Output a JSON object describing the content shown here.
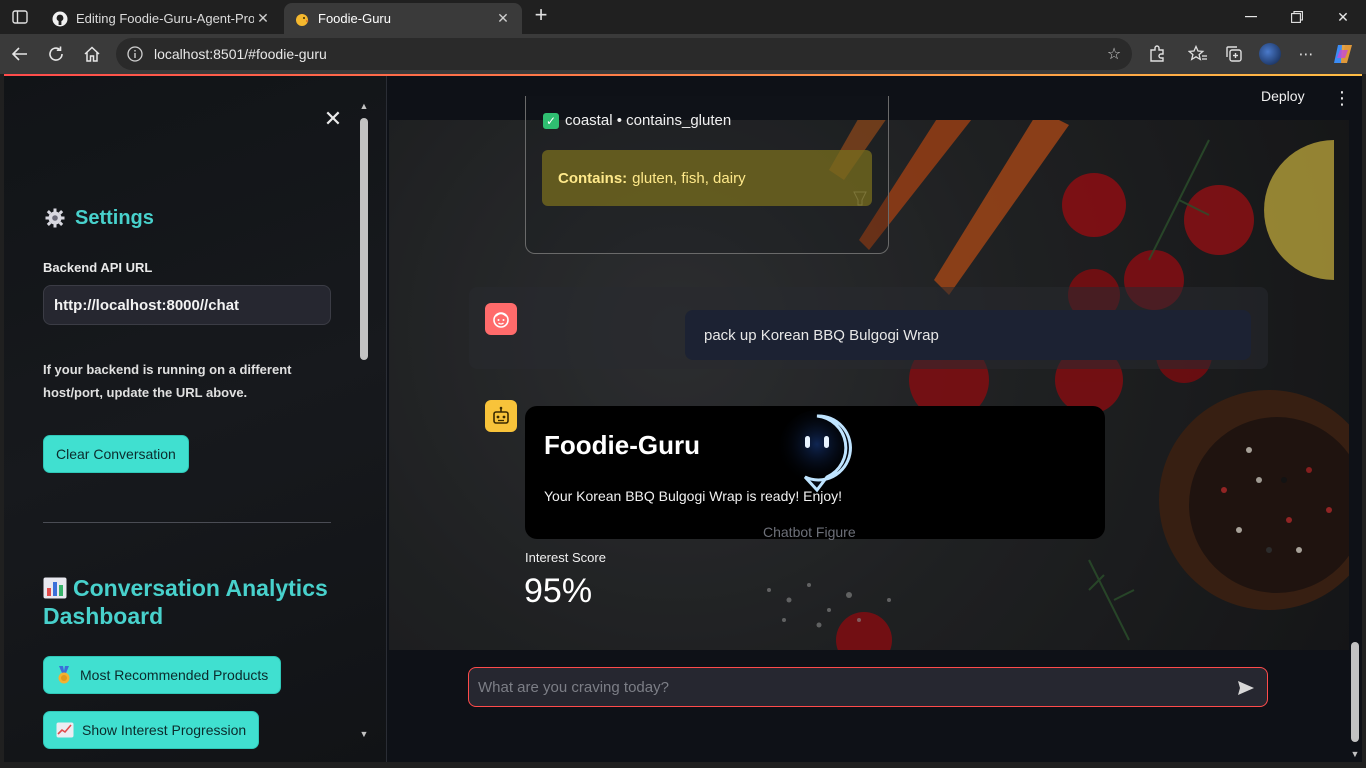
{
  "browser": {
    "tabs": [
      {
        "title": "Editing Foodie-Guru-Agent-Project"
      },
      {
        "title": "Foodie-Guru"
      }
    ],
    "url": "localhost:8501/#foodie-guru"
  },
  "sidebar": {
    "settings_title": "Settings",
    "backend_label": "Backend API URL",
    "backend_value": "http://localhost:8000//chat",
    "help_text": "If your backend is running on a different host/port, update the URL above.",
    "clear_button": "Clear Conversation",
    "dashboard_title": "Conversation Analytics Dashboard",
    "most_recommended_button": "Most Recommended Products",
    "interest_progression_button": "Show Interest Progression"
  },
  "header": {
    "deploy": "Deploy"
  },
  "chat": {
    "tags": "coastal • contains_gluten",
    "contains_label": "Contains:",
    "contains_value": "gluten, fish, dairy",
    "user_message": "pack up Korean BBQ Bulgogi Wrap",
    "bot_name": "Foodie-Guru",
    "bot_message": "Your Korean BBQ Bulgogi Wrap is ready! Enjoy!",
    "figure_caption": "Chatbot Figure",
    "score_label": "Interest Score",
    "score_value": "95%",
    "input_placeholder": "What are you craving today?"
  },
  "colors": {
    "accent": "#40e0d0",
    "heading": "#48d1cc",
    "input_border": "#ff4b4b",
    "background": "#0e1117"
  }
}
